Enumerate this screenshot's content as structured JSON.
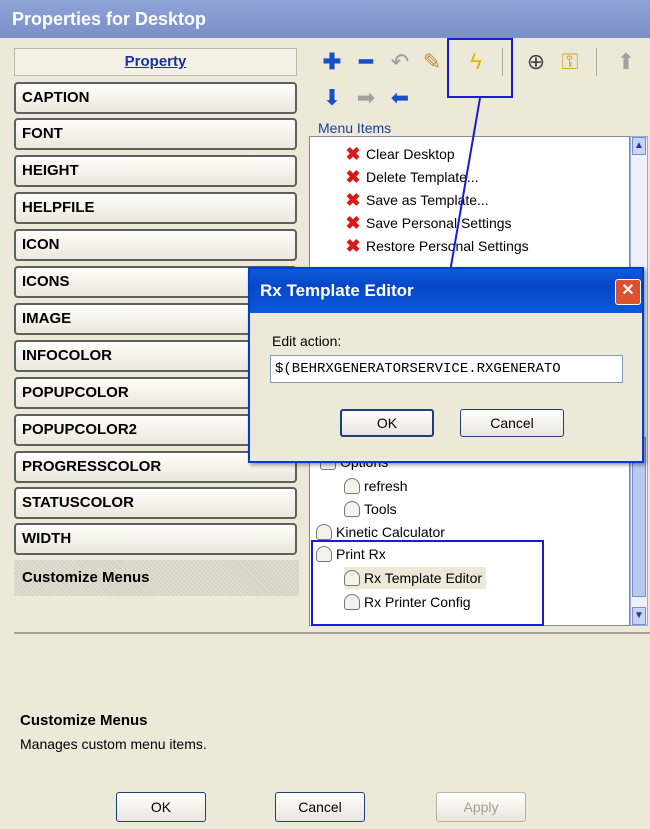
{
  "window": {
    "title": "Properties for Desktop"
  },
  "properties": {
    "header": "Property",
    "items": [
      "CAPTION",
      "FONT",
      "HEIGHT",
      "HELPFILE",
      "ICON",
      "ICONS",
      "IMAGE",
      "INFOCOLOR",
      "POPUPCOLOR",
      "POPUPCOLOR2",
      "PROGRESSCOLOR",
      "STATUSCOLOR",
      "WIDTH"
    ],
    "selected": "Customize Menus"
  },
  "toolbar": {
    "icons": [
      "add-icon",
      "remove-icon",
      "undo-icon",
      "edit-icon",
      "lightning-icon",
      "lock-icon",
      "key-icon",
      "up-arrow-icon",
      "down-arrow-icon",
      "right-arrow-icon",
      "left-arrow-icon"
    ]
  },
  "menu_items": {
    "label": "Menu Items",
    "items": [
      {
        "text": "Clear Desktop",
        "icon": "x-icon"
      },
      {
        "text": "Delete Template...",
        "icon": "x-icon"
      },
      {
        "text": "Save as Template...",
        "icon": "x-icon"
      },
      {
        "text": "Save Personal Settings",
        "icon": "x-icon"
      },
      {
        "text": "Restore Personal Settings",
        "icon": "x-icon"
      },
      {
        "text": "Options",
        "icon": "lock-icon"
      },
      {
        "text": "refresh",
        "icon": "lock-icon"
      },
      {
        "text": "Tools",
        "icon": "lock-icon"
      },
      {
        "text": "Kinetic Calculator",
        "icon": "lock-icon"
      },
      {
        "text": "Print Rx",
        "icon": "lock-icon"
      },
      {
        "text": "Rx Template Editor",
        "icon": "lock-icon",
        "selected": true
      },
      {
        "text": "Rx Printer Config",
        "icon": "lock-icon"
      }
    ]
  },
  "description": {
    "title": "Customize Menus",
    "text": "Manages custom menu items."
  },
  "buttons": {
    "ok": "OK",
    "cancel": "Cancel",
    "apply": "Apply"
  },
  "dialog": {
    "title": "Rx Template Editor",
    "label": "Edit action:",
    "value": "$(BEHRXGENERATORSERVICE.RXGENERATO",
    "ok": "OK",
    "cancel": "Cancel",
    "close": "✕"
  }
}
